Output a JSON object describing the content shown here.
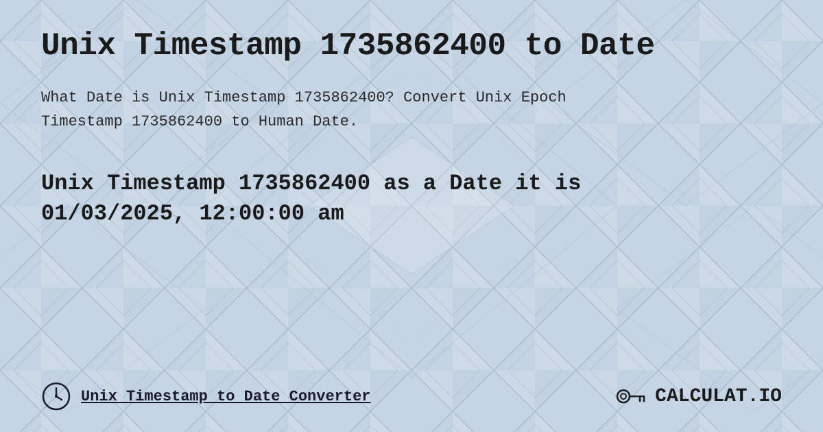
{
  "page": {
    "title": "Unix Timestamp 1735862400 to Date",
    "description_line1": "What Date is Unix Timestamp 1735862400? Convert Unix Epoch",
    "description_line2": "Timestamp 1735862400 to Human Date.",
    "result_line1": "Unix Timestamp 1735862400 as a Date it is",
    "result_line2": "01/03/2025, 12:00:00 am",
    "footer_link": "Unix Timestamp to Date Converter",
    "logo_text": "CALCULAT.IO",
    "background_color": "#c8d8e8"
  }
}
